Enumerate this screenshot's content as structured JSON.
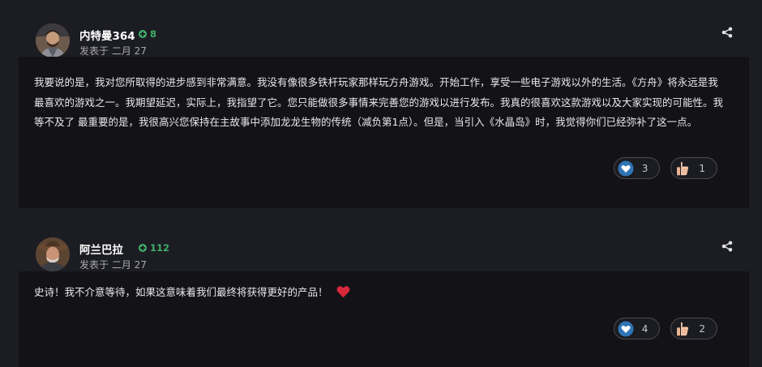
{
  "posts": [
    {
      "author": "内特曼364",
      "reputation": "8",
      "posted": "发表于 二月 27",
      "body": "我要说的是，我对您所取得的进步感到非常满意。我没有像很多铁杆玩家那样玩方舟游戏。开始工作，享受一些电子游戏以外的生活。《方舟》将永远是我最喜欢的游戏之一。我期望延迟，实际上，我指望了它。您只能做很多事情来完善您的游戏以进行发布。我真的很喜欢这款游戏以及大家实现的可能性。我等不及了 最重要的是，我很高兴您保持在主故事中添加龙龙生物的传统（减负第1点）。但是，当引入《水晶岛》时，我觉得你们已经弥补了这一点。",
      "reactions": [
        {
          "icon": "heart-icon",
          "count": "3"
        },
        {
          "icon": "thumbs-up-icon",
          "count": "1"
        }
      ]
    },
    {
      "author": "阿兰巴拉",
      "reputation": "112",
      "posted": "发表于 二月 27",
      "body": "史诗！我不介意等待，如果这意味着我们最终将获得更好的产品！",
      "emoji": "red-heart-emoji",
      "reactions": [
        {
          "icon": "heart-icon",
          "count": "4"
        },
        {
          "icon": "thumbs-up-icon",
          "count": "2"
        }
      ]
    }
  ],
  "colors": {
    "page_bg": "#1c1d22",
    "body_bg": "#131317",
    "reputation_green": "#3fae6a",
    "heart_blue": "#2f74b5",
    "emoji_red": "#d8283a"
  }
}
